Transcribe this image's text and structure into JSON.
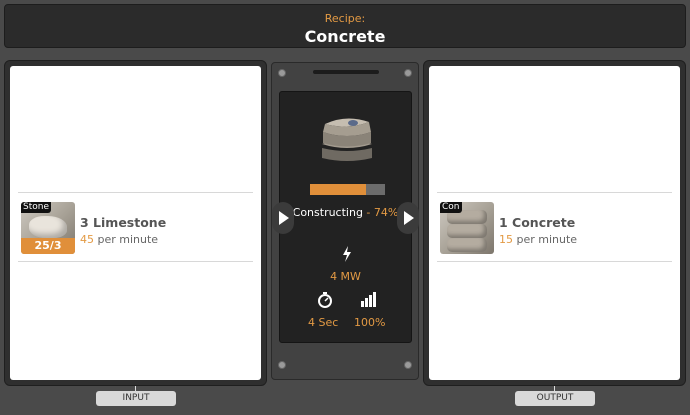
{
  "header": {
    "subtitle": "Recipe:",
    "title": "Concrete"
  },
  "input": {
    "label": "INPUT",
    "item": {
      "tag": "Stone",
      "badge": "25/3",
      "name": "3 Limestone",
      "rate": "45",
      "rate_unit": "per minute"
    }
  },
  "output": {
    "label": "OUTPUT",
    "item": {
      "tag": "Con",
      "name": "1 Concrete",
      "rate": "15",
      "rate_unit": "per minute"
    }
  },
  "machine": {
    "status": "Constructing",
    "separator": " - ",
    "progress_label": "74%",
    "progress_fraction": 0.74,
    "power": "4 MW",
    "time": "4 Sec",
    "efficiency": "100%"
  },
  "colors": {
    "accent": "#e39a44",
    "panel": "#2f2f2f",
    "display": "#222222"
  },
  "icons": [
    "arrow-right-icon",
    "lightning-icon",
    "stopwatch-icon",
    "bar-chart-icon"
  ]
}
